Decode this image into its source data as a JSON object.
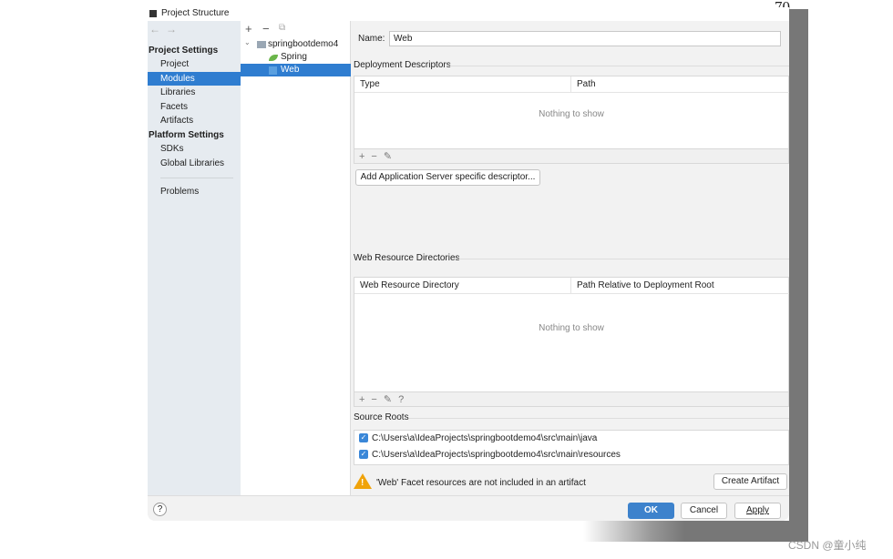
{
  "page_number": "70",
  "watermark": "CSDN @童小纯",
  "window": {
    "title": "Project Structure"
  },
  "sidebar": {
    "back": "←",
    "forward": "→",
    "project_settings": "Project Settings",
    "items": [
      "Project",
      "Modules",
      "Libraries",
      "Facets",
      "Artifacts"
    ],
    "platform_settings": "Platform Settings",
    "platform_items": [
      "SDKs",
      "Global Libraries"
    ],
    "problems": "Problems",
    "selected": "Modules"
  },
  "tree": {
    "toolbar": [
      "+",
      "−",
      "⧉"
    ],
    "root": "springbootdemo4",
    "children": [
      "Spring",
      "Web"
    ],
    "selected": "Web"
  },
  "main": {
    "name_label": "Name:",
    "name_value": "Web",
    "deployment": {
      "title": "Deployment Descriptors",
      "columns": [
        "Type",
        "Path"
      ],
      "empty": "Nothing to show",
      "toolbar": "+−✎",
      "add_button": "Add Application Server specific descriptor..."
    },
    "web_resources": {
      "title": "Web Resource Directories",
      "columns": [
        "Web Resource Directory",
        "Path Relative to Deployment Root"
      ],
      "empty": "Nothing to show",
      "toolbar": "+−✎?"
    },
    "source_roots": {
      "title": "Source Roots",
      "items": [
        {
          "path": "C:\\Users\\a\\IdeaProjects\\springbootdemo4\\src\\main\\java",
          "checked": true
        },
        {
          "path": "C:\\Users\\a\\IdeaProjects\\springbootdemo4\\src\\main\\resources",
          "checked": true
        }
      ]
    },
    "warning": "'Web' Facet resources are not included in an artifact",
    "create_artifact": "Create Artifact"
  },
  "buttons": {
    "help": "?",
    "ok": "OK",
    "cancel": "Cancel",
    "apply": "Apply"
  },
  "colors": {
    "accent": "#2f7dd0",
    "ok": "#3d82cc",
    "warning": "#f0a30a"
  }
}
